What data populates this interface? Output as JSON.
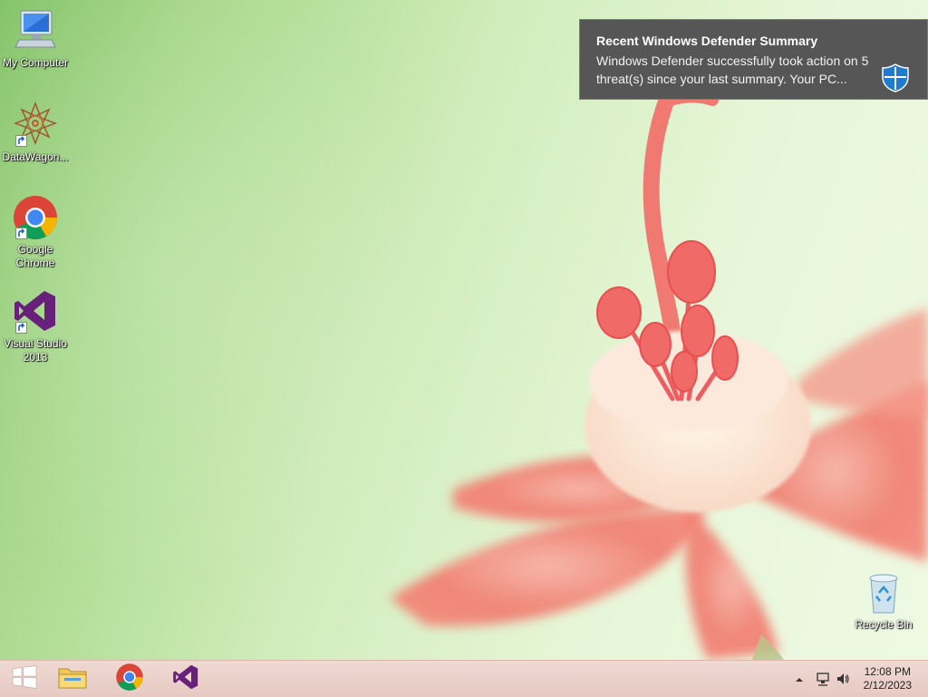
{
  "desktop_icons": [
    {
      "label": "My Computer",
      "icon": "computer-icon"
    },
    {
      "label": "DataWagon...",
      "icon": "datawagon-icon"
    },
    {
      "label": "Google Chrome",
      "icon": "chrome-icon"
    },
    {
      "label": "Visual Studio 2013",
      "icon": "visual-studio-icon"
    }
  ],
  "recycle_bin": {
    "label": "Recycle Bin",
    "icon": "recycle-bin-icon"
  },
  "notification": {
    "title": "Recent Windows Defender Summary",
    "body": "Windows Defender successfully took action on 5 threat(s) since your last summary. Your PC...",
    "icon": "windows-defender-shield-icon",
    "colors": {
      "background": "#565656",
      "shield": "#1e7bd0"
    }
  },
  "taskbar": {
    "pinned": [
      {
        "name": "start-button",
        "icon": "windows-logo-icon"
      },
      {
        "name": "file-explorer",
        "icon": "folder-icon"
      },
      {
        "name": "google-chrome",
        "icon": "chrome-icon"
      },
      {
        "name": "visual-studio",
        "icon": "visual-studio-icon"
      }
    ],
    "tray": {
      "icons": [
        "show-hidden-icons-arrow",
        "network-icon",
        "volume-icon"
      ],
      "time": "12:08 PM",
      "date": "2/12/2023"
    }
  }
}
